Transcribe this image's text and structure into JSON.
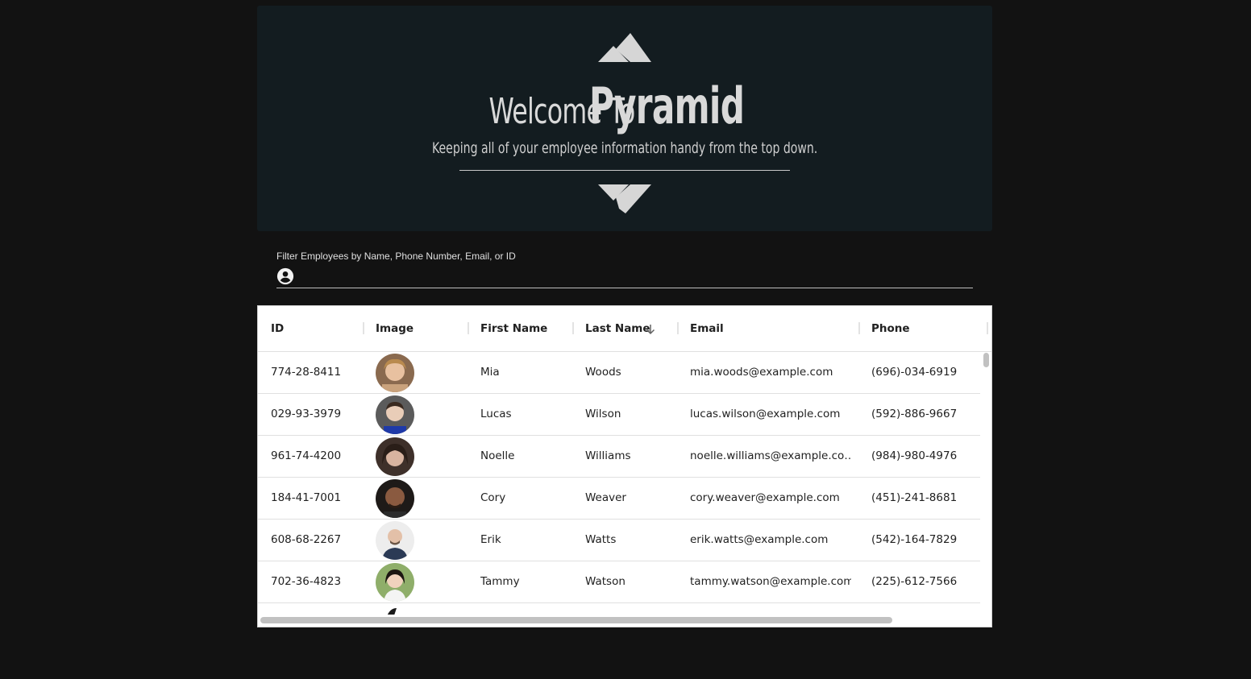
{
  "hero": {
    "welcome": "Welcome To",
    "brand": "Pyramid",
    "subtitle": "Keeping all of your employee information handy from the top down."
  },
  "filter": {
    "label": "Filter Employees by Name, Phone Number, Email, or ID",
    "value": "",
    "icon": "account-circle-icon"
  },
  "table": {
    "columns": [
      "ID",
      "Image",
      "First Name",
      "Last Name",
      "Email",
      "Phone"
    ],
    "sort": {
      "column": "Last Name",
      "direction": "descending",
      "icon": "arrow-down-icon"
    },
    "rows": [
      {
        "id": "774-28-8411",
        "first": "Mia",
        "last": "Woods",
        "email": "mia.woods@example.com",
        "phone": "(696)-034-6919"
      },
      {
        "id": "029-93-3979",
        "first": "Lucas",
        "last": "Wilson",
        "email": "lucas.wilson@example.com",
        "phone": "(592)-886-9667"
      },
      {
        "id": "961-74-4200",
        "first": "Noelle",
        "last": "Williams",
        "email": "noelle.williams@example.co…",
        "phone": "(984)-980-4976"
      },
      {
        "id": "184-41-7001",
        "first": "Cory",
        "last": "Weaver",
        "email": "cory.weaver@example.com",
        "phone": "(451)-241-8681"
      },
      {
        "id": "608-68-2267",
        "first": "Erik",
        "last": "Watts",
        "email": "erik.watts@example.com",
        "phone": "(542)-164-7829"
      },
      {
        "id": "702-36-4823",
        "first": "Tammy",
        "last": "Watson",
        "email": "tammy.watson@example.com",
        "phone": "(225)-612-7566"
      }
    ]
  },
  "colors": {
    "page_bg": "#121212",
    "hero_bg": "#131c20",
    "hero_text": "#d9d9d9",
    "grid_bg": "#ffffff",
    "grid_text": "#212121"
  }
}
